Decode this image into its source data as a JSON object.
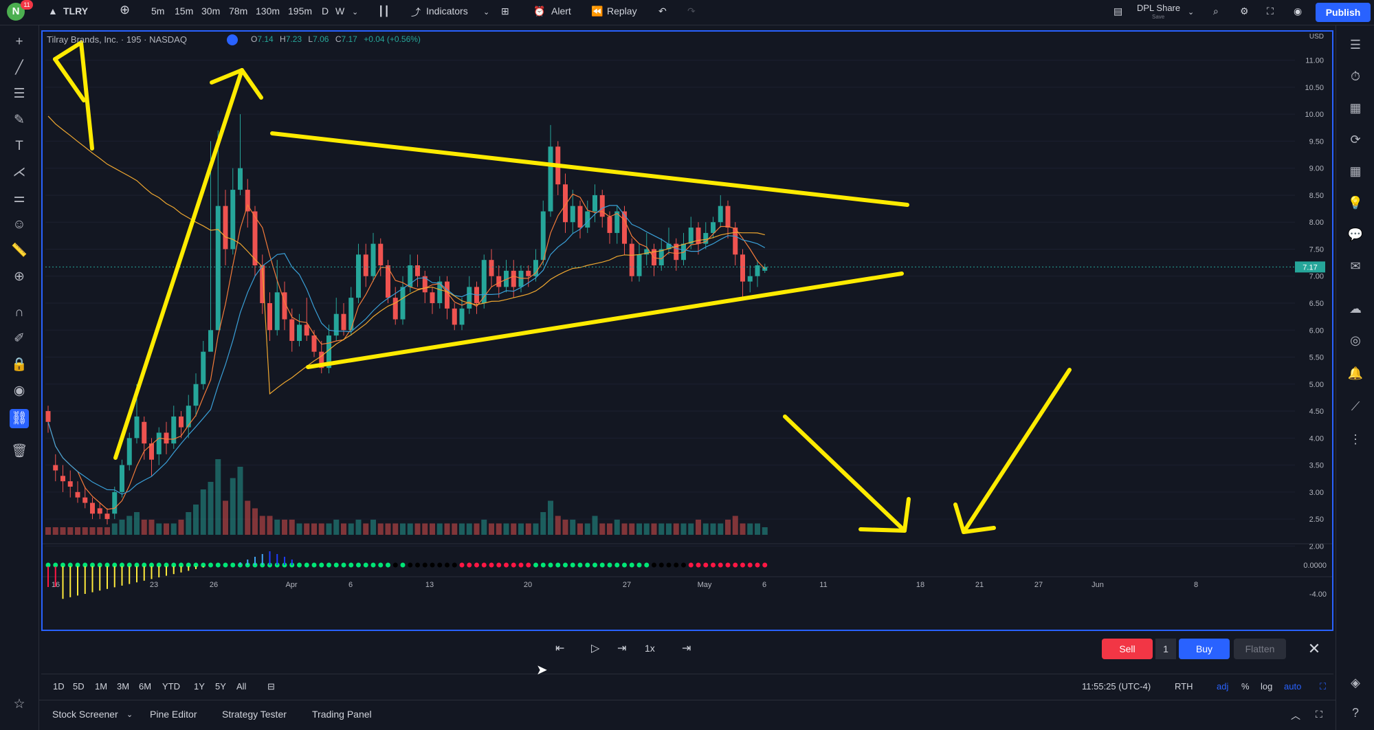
{
  "topbar": {
    "avatar_letter": "N",
    "notification_count": "11",
    "symbol": "TLRY",
    "intervals": [
      "5m",
      "15m",
      "30m",
      "78m",
      "130m",
      "195m",
      "D",
      "W"
    ],
    "active_interval": "195m",
    "indicators_label": "Indicators",
    "alert_label": "Alert",
    "replay_label": "Replay",
    "layout_name": "DPL Share",
    "layout_sub": "Save",
    "publish_label": "Publish"
  },
  "legend": {
    "title": "Tilray Brands, Inc. · 195 · NASDAQ",
    "o_label": "O",
    "o": "7.14",
    "h_label": "H",
    "h": "7.23",
    "l_label": "L",
    "l": "7.06",
    "c_label": "C",
    "c": "7.17",
    "change": "+0.04 (+0.56%)"
  },
  "price_axis": {
    "currency": "USD",
    "ticks": [
      "11.00",
      "10.50",
      "10.00",
      "9.50",
      "9.00",
      "8.50",
      "8.00",
      "7.50",
      "7.00",
      "6.50",
      "6.00",
      "5.50",
      "5.00",
      "4.50",
      "4.00",
      "3.50",
      "3.00",
      "2.50",
      "2.00"
    ],
    "last_price": "7.17"
  },
  "oscillator_axis": {
    "ticks": [
      "0.0000",
      "-4.00"
    ]
  },
  "time_axis": {
    "ticks": [
      "16",
      "23",
      "26",
      "Apr",
      "6",
      "13",
      "20",
      "27",
      "May",
      "6",
      "11",
      "18",
      "21",
      "27",
      "Jun",
      "8"
    ]
  },
  "replay_controls": {
    "speed": "1x"
  },
  "trade": {
    "sell_label": "Sell",
    "quantity": "1",
    "buy_label": "Buy",
    "flatten_label": "Flatten"
  },
  "ranges": [
    "1D",
    "5D",
    "1M",
    "3M",
    "6M",
    "YTD",
    "1Y",
    "5Y",
    "All"
  ],
  "status": {
    "time": "11:55:25 (UTC-4)",
    "session": "RTH",
    "adj": "adj",
    "percent": "%",
    "log": "log",
    "auto": "auto"
  },
  "panels": {
    "stock_screener": "Stock Screener",
    "pine_editor": "Pine Editor",
    "strategy_tester": "Strategy Tester",
    "trading_panel": "Trading Panel"
  },
  "colors": {
    "background": "#131722",
    "up": "#26a69a",
    "down": "#ef5350",
    "accent": "#2962ff",
    "annotation": "#ffeb00",
    "ma_fast": "#f57c3a",
    "ma_slow": "#f0a830",
    "ma_mid": "#3aa0d8"
  },
  "chart_data": {
    "type": "candlestick",
    "price_range": [
      1.75,
      11.25
    ],
    "candles": [
      [
        4.5,
        4.3,
        4.6,
        4.1
      ],
      [
        3.5,
        3.4,
        3.7,
        3.2
      ],
      [
        3.3,
        3.2,
        3.5,
        3.0
      ],
      [
        3.2,
        3.1,
        3.4,
        2.9
      ],
      [
        3.0,
        2.9,
        3.2,
        2.8
      ],
      [
        2.9,
        2.8,
        3.1,
        2.7
      ],
      [
        2.8,
        2.6,
        2.9,
        2.5
      ],
      [
        2.7,
        2.6,
        2.8,
        2.5
      ],
      [
        2.6,
        2.5,
        2.7,
        2.4
      ],
      [
        2.6,
        3.0,
        3.1,
        2.5
      ],
      [
        3.0,
        3.5,
        3.6,
        2.9
      ],
      [
        3.5,
        4.0,
        4.1,
        3.4
      ],
      [
        4.0,
        4.4,
        5.0,
        3.9
      ],
      [
        4.3,
        3.9,
        4.4,
        3.6
      ],
      [
        3.9,
        3.6,
        4.0,
        3.3
      ],
      [
        3.7,
        4.1,
        4.2,
        3.5
      ],
      [
        4.1,
        3.9,
        4.3,
        3.7
      ],
      [
        3.9,
        4.4,
        4.6,
        3.8
      ],
      [
        4.4,
        4.2,
        4.5,
        4.0
      ],
      [
        4.2,
        4.6,
        4.8,
        4.0
      ],
      [
        4.6,
        5.0,
        5.2,
        4.4
      ],
      [
        5.0,
        5.6,
        5.8,
        4.9
      ],
      [
        5.6,
        6.0,
        9.5,
        5.8
      ],
      [
        6.0,
        8.3,
        9.7,
        6.0
      ],
      [
        8.3,
        7.5,
        8.6,
        7.2
      ],
      [
        7.5,
        8.6,
        9.0,
        7.4
      ],
      [
        8.6,
        9.0,
        10.0,
        8.5
      ],
      [
        8.6,
        8.2,
        8.8,
        7.9
      ],
      [
        8.2,
        7.2,
        8.3,
        7.0
      ],
      [
        7.2,
        6.5,
        7.4,
        6.3
      ],
      [
        6.5,
        6.0,
        6.7,
        5.8
      ],
      [
        6.0,
        6.7,
        7.3,
        5.9
      ],
      [
        6.7,
        6.2,
        6.9,
        6.0
      ],
      [
        6.2,
        5.8,
        6.4,
        5.6
      ],
      [
        5.8,
        6.1,
        6.3,
        5.7
      ],
      [
        6.1,
        5.9,
        6.6,
        5.8
      ],
      [
        5.9,
        5.6,
        6.0,
        5.5
      ],
      [
        5.6,
        5.3,
        5.8,
        5.2
      ],
      [
        5.3,
        5.9,
        6.1,
        5.2
      ],
      [
        5.9,
        6.3,
        6.6,
        5.8
      ],
      [
        6.3,
        6.0,
        6.5,
        5.9
      ],
      [
        6.0,
        6.6,
        6.8,
        5.9
      ],
      [
        6.6,
        7.4,
        7.6,
        6.5
      ],
      [
        7.4,
        7.0,
        7.6,
        6.8
      ],
      [
        7.0,
        7.6,
        7.8,
        6.9
      ],
      [
        7.6,
        7.2,
        7.7,
        7.0
      ],
      [
        7.2,
        6.6,
        7.3,
        6.5
      ],
      [
        6.6,
        6.2,
        6.8,
        6.1
      ],
      [
        6.2,
        6.8,
        7.0,
        6.1
      ],
      [
        6.8,
        7.2,
        7.4,
        6.7
      ],
      [
        7.2,
        7.0,
        7.4,
        6.8
      ],
      [
        7.0,
        6.7,
        7.1,
        6.5
      ],
      [
        6.7,
        6.5,
        6.8,
        6.3
      ],
      [
        6.5,
        6.9,
        7.0,
        6.4
      ],
      [
        6.9,
        6.4,
        7.0,
        6.2
      ],
      [
        6.4,
        6.1,
        6.5,
        6.0
      ],
      [
        6.1,
        6.4,
        6.6,
        6.0
      ],
      [
        6.4,
        6.8,
        7.0,
        6.3
      ],
      [
        6.8,
        6.5,
        6.9,
        6.3
      ],
      [
        6.5,
        7.3,
        7.4,
        6.4
      ],
      [
        7.3,
        7.0,
        7.5,
        6.8
      ],
      [
        7.0,
        6.8,
        7.2,
        6.6
      ],
      [
        6.8,
        7.1,
        7.3,
        6.7
      ],
      [
        7.1,
        6.8,
        7.3,
        6.6
      ],
      [
        6.8,
        7.1,
        7.2,
        6.7
      ],
      [
        7.1,
        7.0,
        7.2,
        6.8
      ],
      [
        7.0,
        7.3,
        7.5,
        6.9
      ],
      [
        7.3,
        8.2,
        8.4,
        7.2
      ],
      [
        8.2,
        9.4,
        9.8,
        8.1
      ],
      [
        9.4,
        8.7,
        9.5,
        8.5
      ],
      [
        8.7,
        8.0,
        8.9,
        7.8
      ],
      [
        8.0,
        8.3,
        8.6,
        7.8
      ],
      [
        8.3,
        7.9,
        8.4,
        7.7
      ],
      [
        7.9,
        8.2,
        8.4,
        7.8
      ],
      [
        8.2,
        8.5,
        8.7,
        8.0
      ],
      [
        8.5,
        8.1,
        8.6,
        7.9
      ],
      [
        8.1,
        7.8,
        8.2,
        7.6
      ],
      [
        7.8,
        8.2,
        8.3,
        7.6
      ],
      [
        8.2,
        7.6,
        8.3,
        7.4
      ],
      [
        7.6,
        7.0,
        7.7,
        6.9
      ],
      [
        7.0,
        7.4,
        7.6,
        6.9
      ],
      [
        7.4,
        7.5,
        7.8,
        7.2
      ],
      [
        7.5,
        7.2,
        7.6,
        7.0
      ],
      [
        7.2,
        7.5,
        7.7,
        7.1
      ],
      [
        7.5,
        7.6,
        7.9,
        7.4
      ],
      [
        7.6,
        7.3,
        7.7,
        7.1
      ],
      [
        7.3,
        7.6,
        7.8,
        7.2
      ],
      [
        7.6,
        7.9,
        8.1,
        7.5
      ],
      [
        7.9,
        7.6,
        8.0,
        7.4
      ],
      [
        7.6,
        7.8,
        8.0,
        7.5
      ],
      [
        7.8,
        8.0,
        8.1,
        7.7
      ],
      [
        8.0,
        8.3,
        8.5,
        7.9
      ],
      [
        8.3,
        7.9,
        8.4,
        7.7
      ],
      [
        7.9,
        7.4,
        8.0,
        7.2
      ],
      [
        7.4,
        6.9,
        7.5,
        6.6
      ],
      [
        6.9,
        7.0,
        7.2,
        6.7
      ],
      [
        7.0,
        7.2,
        7.3,
        6.8
      ],
      [
        7.1,
        7.17,
        7.23,
        7.06
      ]
    ],
    "volumes": [
      2,
      2,
      2,
      2,
      2,
      2,
      2,
      2,
      2,
      3,
      4,
      5,
      6,
      4,
      4,
      3,
      3,
      3,
      4,
      6,
      8,
      12,
      14,
      20,
      9,
      15,
      18,
      9,
      7,
      5,
      5,
      4,
      4,
      4,
      3,
      3,
      3,
      3,
      3,
      4,
      3,
      3,
      4,
      3,
      4,
      3,
      3,
      3,
      3,
      3,
      3,
      3,
      3,
      3,
      3,
      3,
      3,
      3,
      3,
      4,
      3,
      3,
      3,
      3,
      3,
      3,
      3,
      6,
      9,
      5,
      4,
      4,
      3,
      3,
      5,
      3,
      3,
      4,
      3,
      3,
      3,
      3,
      3,
      3,
      3,
      3,
      3,
      3,
      4,
      3,
      3,
      3,
      4,
      5,
      3,
      3,
      3
    ],
    "oscillator_dots": "green from Mar 17 to Apr 11, mixed to Apr 13, black to Apr 18, red Apr 18-26, green Apr 26-May 8, black, red May 11-15"
  }
}
